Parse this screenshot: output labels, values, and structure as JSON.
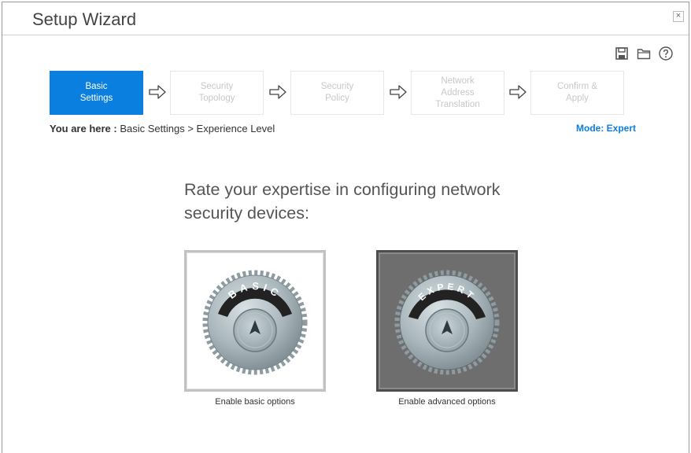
{
  "window": {
    "title": "Setup Wizard",
    "close_label": "×"
  },
  "toolbar": {
    "icons": [
      "save-icon",
      "folder-icon",
      "help-icon"
    ]
  },
  "steps": [
    {
      "label": "Basic\nSettings",
      "active": true
    },
    {
      "label": "Security\nTopology",
      "active": false
    },
    {
      "label": "Security\nPolicy",
      "active": false
    },
    {
      "label": "Network\nAddress\nTranslation",
      "active": false
    },
    {
      "label": "Confirm &\nApply",
      "active": false
    }
  ],
  "breadcrumb": {
    "prefix": "You are here :",
    "path": "Basic Settings > Experience Level"
  },
  "mode": "Mode: Expert",
  "question": "Rate your expertise in configuring network security devices:",
  "options": [
    {
      "dial_text": "BASIC",
      "caption": "Enable basic options",
      "selected": false
    },
    {
      "dial_text": "EXPERT",
      "caption": "Enable advanced options",
      "selected": true
    }
  ],
  "colors": {
    "accent": "#0a7fe0",
    "inactive_step_text": "#c8c8c8",
    "selected_frame": "#6e6e6e"
  }
}
